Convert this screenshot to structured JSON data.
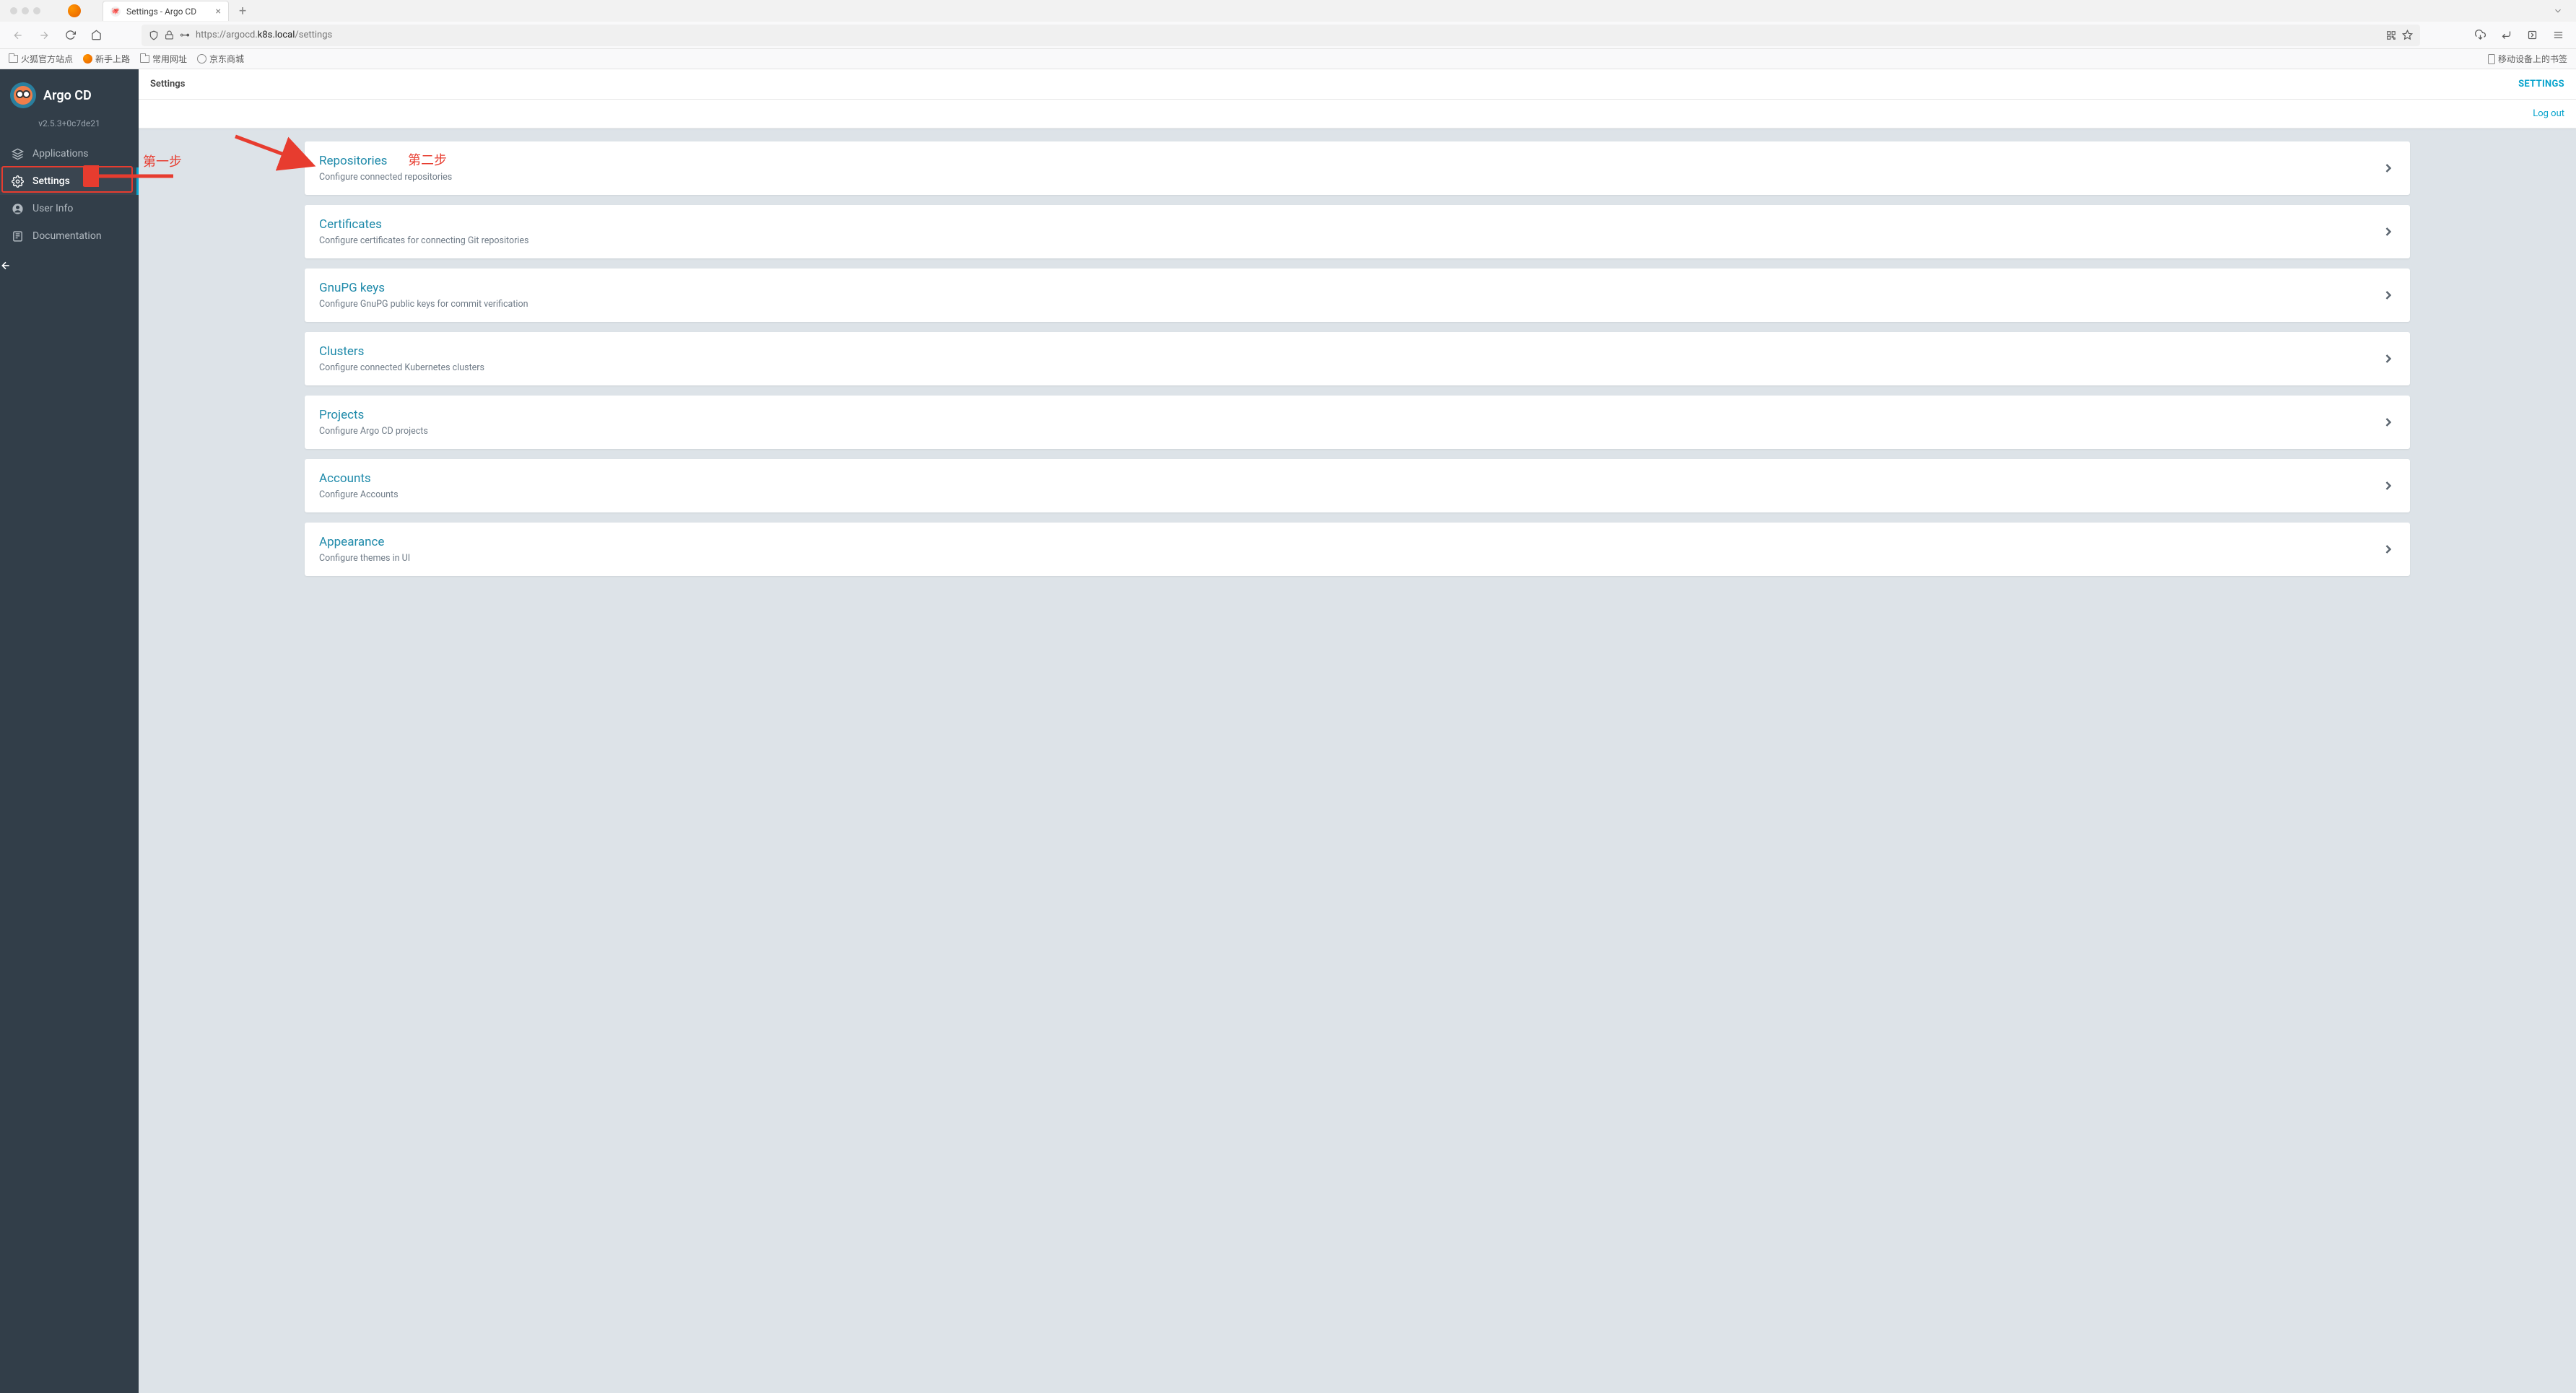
{
  "browser": {
    "tab_title": "Settings - Argo CD",
    "url_prefix": "https://argocd.",
    "url_bold": "k8s.local",
    "url_suffix": "/settings",
    "bookmarks": [
      "火狐官方站点",
      "新手上路",
      "常用网址",
      "京东商城"
    ],
    "mobile_bookmarks": "移动设备上的书签"
  },
  "sidebar": {
    "title": "Argo CD",
    "version": "v2.5.3+0c7de21",
    "items": [
      {
        "label": "Applications",
        "active": false
      },
      {
        "label": "Settings",
        "active": true
      },
      {
        "label": "User Info",
        "active": false
      },
      {
        "label": "Documentation",
        "active": false
      }
    ]
  },
  "header": {
    "breadcrumb": "Settings",
    "right_label": "SETTINGS",
    "logout": "Log out"
  },
  "cards": [
    {
      "title": "Repositories",
      "desc": "Configure connected repositories"
    },
    {
      "title": "Certificates",
      "desc": "Configure certificates for connecting Git repositories"
    },
    {
      "title": "GnuPG keys",
      "desc": "Configure GnuPG public keys for commit verification"
    },
    {
      "title": "Clusters",
      "desc": "Configure connected Kubernetes clusters"
    },
    {
      "title": "Projects",
      "desc": "Configure Argo CD projects"
    },
    {
      "title": "Accounts",
      "desc": "Configure Accounts"
    },
    {
      "title": "Appearance",
      "desc": "Configure themes in UI"
    }
  ],
  "annotations": {
    "step1": "第一步",
    "step2": "第二步"
  }
}
